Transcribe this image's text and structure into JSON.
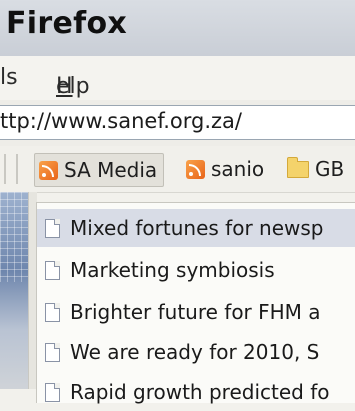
{
  "window": {
    "title": "Firefox"
  },
  "menu": {
    "tools_fragment": "ls",
    "help_label": "Help",
    "help_accel": "H",
    "help_rest": "elp"
  },
  "address": {
    "url": "ttp://www.sanef.org.za/"
  },
  "bookmarks": [
    {
      "label": "SA Media",
      "icon": "rss-feed-icon"
    },
    {
      "label": "sanio",
      "icon": "rss-feed-icon"
    },
    {
      "label": "GB",
      "icon": "folder-icon"
    }
  ],
  "dropdown": {
    "items": [
      {
        "label": "Mixed fortunes for newsp",
        "highlighted": true
      },
      {
        "label": "Marketing symbiosis"
      },
      {
        "label": "Brighter future for FHM a"
      },
      {
        "label": "We are ready for 2010, S"
      },
      {
        "label": "Rapid growth predicted fo"
      }
    ]
  },
  "colors": {
    "titlebar": "#d0d5dc",
    "highlight": "#d8dce6",
    "menubar": "#f4f3ef"
  }
}
